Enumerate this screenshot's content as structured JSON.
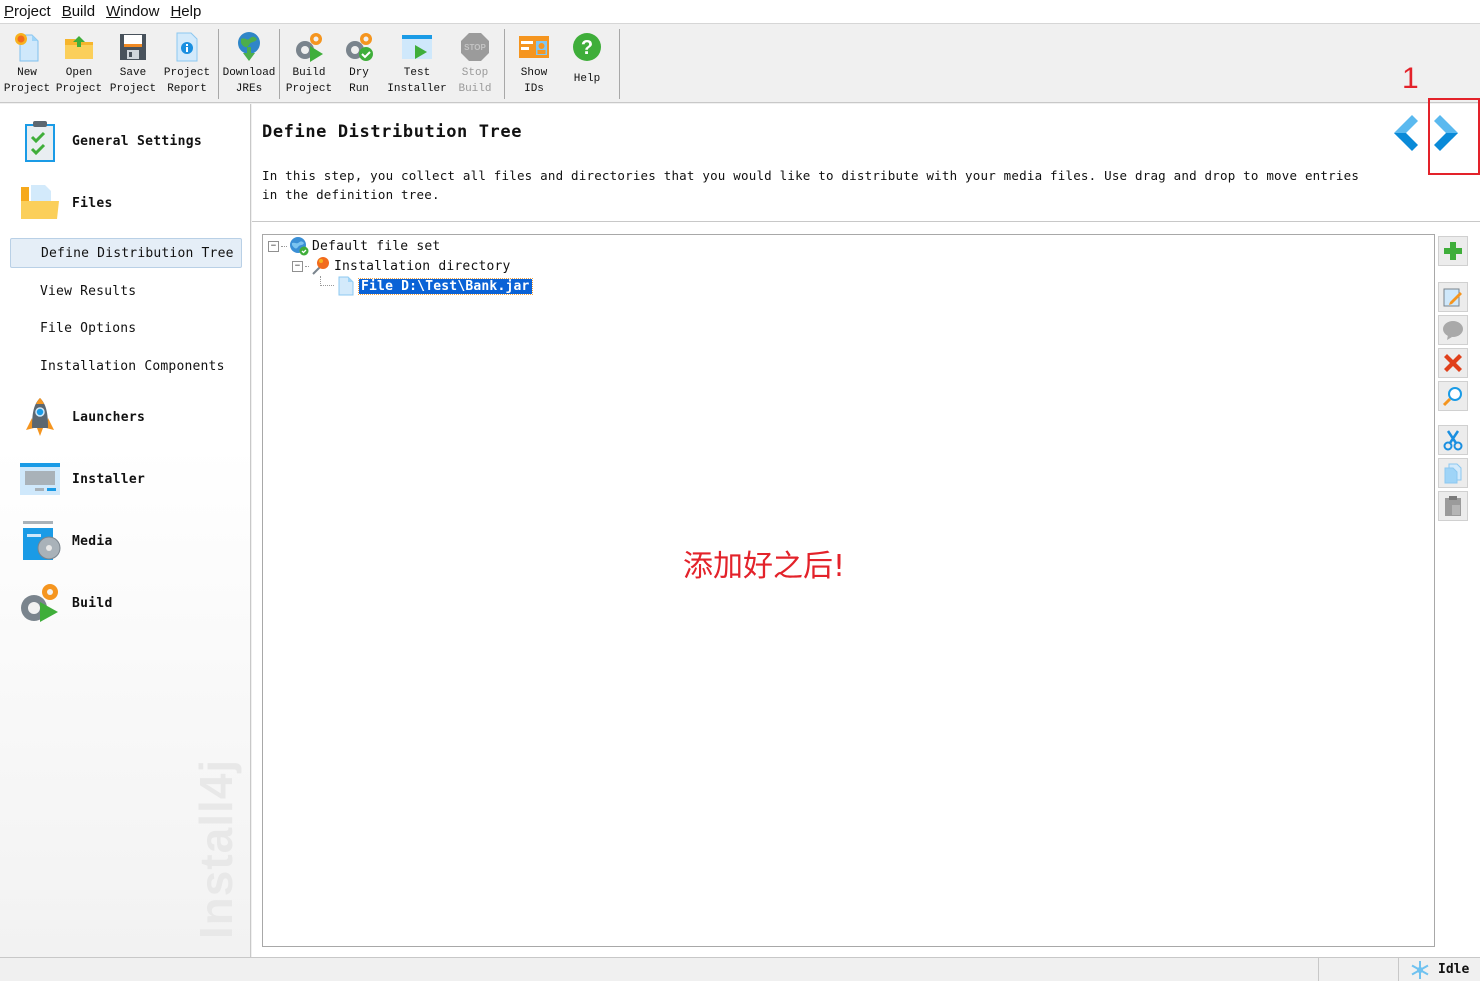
{
  "menu": [
    {
      "label": "Project",
      "mnemonic": "P"
    },
    {
      "label": "Build",
      "mnemonic": "B"
    },
    {
      "label": "Window",
      "mnemonic": "W"
    },
    {
      "label": "Help",
      "mnemonic": "H"
    }
  ],
  "toolbar": {
    "new_project": "New\nProject",
    "open_project": "Open\nProject",
    "save_project": "Save\nProject",
    "project_report": "Project\nReport",
    "download_jres": "Download\nJREs",
    "build_project": "Build\nProject",
    "dry_run": "Dry\nRun",
    "test_installer": "Test\nInstaller",
    "stop_build": "Stop\nBuild",
    "show_ids": "Show\nIDs",
    "help": "Help"
  },
  "sidebar": {
    "general_settings": "General Settings",
    "files": "Files",
    "files_sub": [
      {
        "label": "Define Distribution Tree",
        "active": true
      },
      {
        "label": "View Results",
        "active": false
      },
      {
        "label": "File Options",
        "active": false
      },
      {
        "label": "Installation Components",
        "active": false
      }
    ],
    "launchers": "Launchers",
    "installer": "Installer",
    "media": "Media",
    "build": "Build",
    "watermark": "Install4j"
  },
  "main": {
    "title": "Define Distribution Tree",
    "description": "In this step, you collect all files and directories that you would like to distribute with your media files. Use drag and drop to move entries in the definition tree.",
    "tree": {
      "root": "Default file set",
      "child": "Installation directory",
      "leaf": "File D:\\Test\\Bank.jar"
    },
    "annotation_text": "添加好之后!",
    "annotation_number": "1"
  },
  "status": {
    "text": "Idle"
  },
  "colors": {
    "accent_blue": "#1a9be6",
    "annotation_red": "#e3222a",
    "selection": "#0a62d6"
  }
}
